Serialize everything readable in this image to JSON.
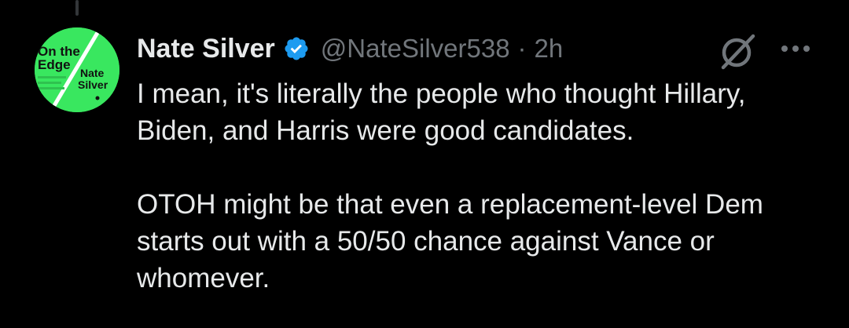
{
  "author": {
    "display_name": "Nate Silver",
    "handle": "@NateSilver538",
    "separator": "·",
    "time_ago": "2h",
    "verified": true,
    "avatar": {
      "line1": "On the",
      "line2": "Edge",
      "line3": "Nate",
      "line4": "Silver"
    }
  },
  "tweet": {
    "paragraph1": "I mean, it's literally the people who thought Hillary, Biden, and Harris were good candidates.",
    "paragraph2": "OTOH might be that even a replacement-level Dem starts out with a 50/50 chance against Vance or whomever."
  },
  "icons": {
    "verified": "verified-badge-icon",
    "grok": "grok-icon",
    "more": "more-options-icon"
  },
  "colors": {
    "background": "#000000",
    "text_primary": "#e7e9ea",
    "text_secondary": "#71767b",
    "verified_blue": "#1d9bf0",
    "avatar_green": "#39e75f"
  }
}
